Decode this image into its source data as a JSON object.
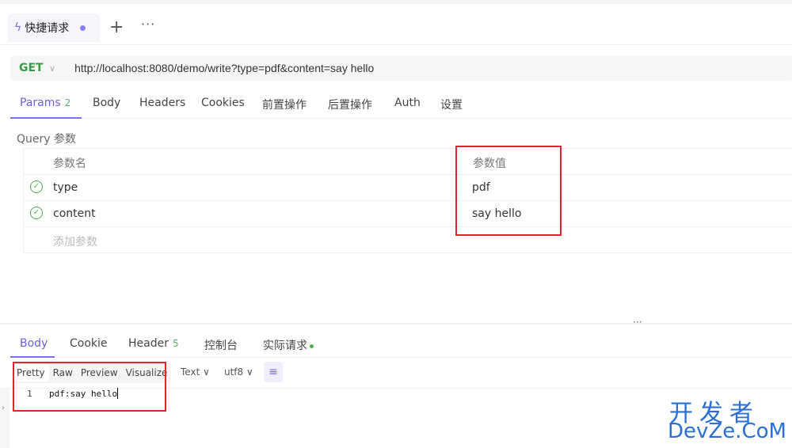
{
  "tabbar": {
    "tab_label": "快捷请求",
    "plus": "+",
    "more": "···"
  },
  "urlbar": {
    "method": "GET",
    "chevron": "∨",
    "url": "http://localhost:8080/demo/write?type=pdf&content=say hello"
  },
  "request_tabs": [
    {
      "label": "Params",
      "badge": "2"
    },
    {
      "label": "Body"
    },
    {
      "label": "Headers"
    },
    {
      "label": "Cookies"
    },
    {
      "label": "前置操作"
    },
    {
      "label": "后置操作"
    },
    {
      "label": "Auth"
    },
    {
      "label": "设置"
    }
  ],
  "query": {
    "title": "Query 参数",
    "header_name": "参数名",
    "header_value": "参数值",
    "rows": [
      {
        "name": "type",
        "value": "pdf"
      },
      {
        "name": "content",
        "value": "say hello"
      }
    ],
    "add_placeholder": "添加参数"
  },
  "splitter_dots": "···",
  "response_tabs": [
    {
      "label": "Body"
    },
    {
      "label": "Cookie"
    },
    {
      "label": "Header",
      "badge": "5"
    },
    {
      "label": "控制台"
    },
    {
      "label": "实际请求"
    }
  ],
  "view_modes": [
    "Pretty",
    "Raw",
    "Preview",
    "Visualize"
  ],
  "format_select": "Text ∨",
  "encoding_select": "utf8 ∨",
  "wrap_icon": "≡",
  "response": {
    "line_number": "1",
    "text": "pdf:say hello"
  },
  "rail_chevron": "›",
  "watermark": {
    "top": "开发者",
    "bottom": "DevZe.CoM"
  },
  "colors": {
    "accent": "#7a6df0",
    "method": "#3a9a4a",
    "highlight_box": "#e0242f",
    "watermark": "#2a6fd6"
  },
  "icons": {
    "tab": "lightning-icon",
    "check": "check-circle-icon",
    "wrap": "wrap-lines-icon"
  }
}
